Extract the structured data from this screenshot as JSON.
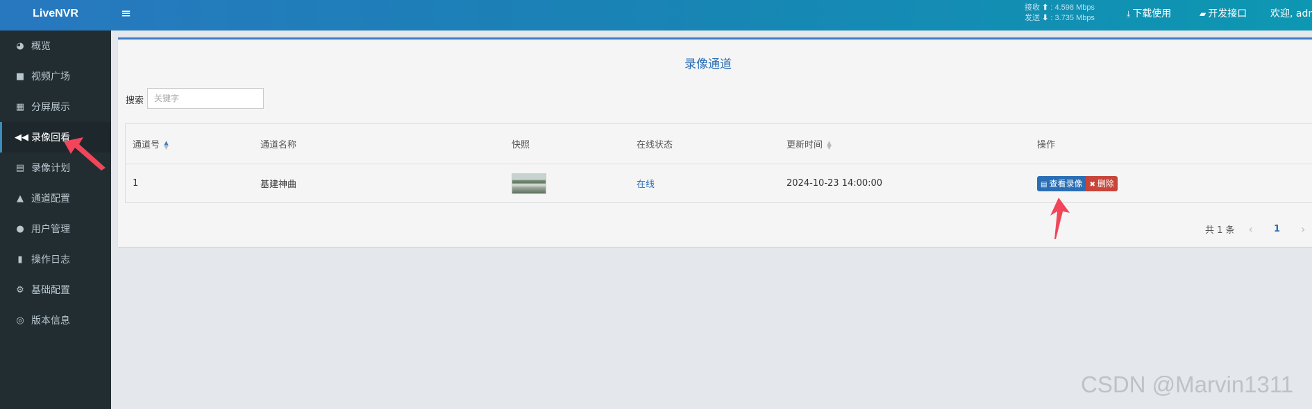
{
  "app": {
    "brand": "LiveNVR"
  },
  "header": {
    "menu_icon": "hamburger-icon",
    "net": {
      "recv_label": "接收",
      "recv_value": "4.598 Mbps",
      "send_label": "发送",
      "send_value": "3.735 Mbps"
    },
    "download_label": "下载使用",
    "api_label": "开发接口",
    "welcome": "欢迎, adm"
  },
  "sidebar": {
    "items": [
      {
        "label": "概览",
        "icon": "dashboard-icon",
        "glyph": "◕"
      },
      {
        "label": "视频广场",
        "icon": "video-camera-icon",
        "glyph": "■"
      },
      {
        "label": "分屏展示",
        "icon": "grid-icon",
        "glyph": "▦"
      },
      {
        "label": "录像回看",
        "icon": "rewind-icon",
        "glyph": "◀◀",
        "active": true
      },
      {
        "label": "录像计划",
        "icon": "calendar-icon",
        "glyph": "▤"
      },
      {
        "label": "通道配置",
        "icon": "road-icon",
        "glyph": "▲"
      },
      {
        "label": "用户管理",
        "icon": "users-icon",
        "glyph": "●"
      },
      {
        "label": "操作日志",
        "icon": "file-icon",
        "glyph": "▮"
      },
      {
        "label": "基础配置",
        "icon": "gears-icon",
        "glyph": "⚙"
      },
      {
        "label": "版本信息",
        "icon": "support-icon",
        "glyph": "◎"
      }
    ]
  },
  "main": {
    "title": "录像通道",
    "search": {
      "label": "搜索",
      "placeholder": "关键字"
    },
    "table": {
      "columns": [
        "通道号",
        "通道名称",
        "快照",
        "在线状态",
        "更新时间",
        "操作"
      ],
      "rows": [
        {
          "channel": "1",
          "name": "基建神曲",
          "status": "在线",
          "updated": "2024-10-23 14:00:00",
          "view_label": "查看录像",
          "delete_label": "删除"
        }
      ]
    },
    "pager": {
      "total": "共 1 条",
      "current": "1"
    }
  },
  "colors": {
    "accent": "#2a6eb8",
    "sidebar_bg": "#222d32",
    "danger": "#c8453a",
    "annotation": "#f2455a"
  },
  "watermark": "CSDN @Marvin1311"
}
